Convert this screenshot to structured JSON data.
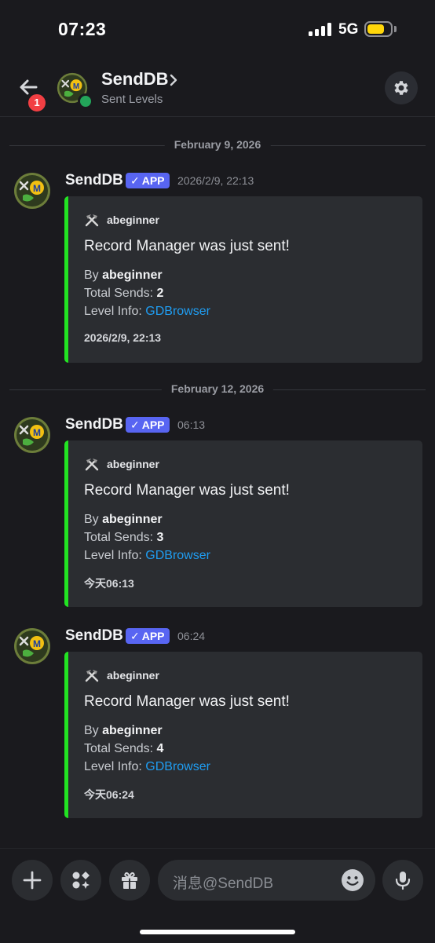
{
  "status_bar": {
    "time": "07:23",
    "network": "5G",
    "battery_level": 0.75
  },
  "header": {
    "badge_count": "1",
    "title": "SendDB",
    "subtitle": "Sent Levels"
  },
  "dates": [
    "February 9, 2026",
    "February 12, 2026"
  ],
  "messages": [
    {
      "author": "SendDB",
      "tag": "APP",
      "tag_check": "✓",
      "time": "2026/2/9, 22:13",
      "embed": {
        "author": "abeginner",
        "title": "Record Manager was just sent!",
        "by_label": "By",
        "by_value": "abeginner",
        "sends_label": "Total Sends:",
        "sends_value": "2",
        "level_label": "Level Info:",
        "level_link": "GDBrowser",
        "footer": "2026/2/9, 22:13"
      }
    },
    {
      "author": "SendDB",
      "tag": "APP",
      "tag_check": "✓",
      "time": "06:13",
      "embed": {
        "author": "abeginner",
        "title": "Record Manager was just sent!",
        "by_label": "By",
        "by_value": "abeginner",
        "sends_label": "Total Sends:",
        "sends_value": "3",
        "level_label": "Level Info:",
        "level_link": "GDBrowser",
        "footer": "今天06:13"
      }
    },
    {
      "author": "SendDB",
      "tag": "APP",
      "tag_check": "✓",
      "time": "06:24",
      "embed": {
        "author": "abeginner",
        "title": "Record Manager was just sent!",
        "by_label": "By",
        "by_value": "abeginner",
        "sends_label": "Total Sends:",
        "sends_value": "4",
        "level_label": "Level Info:",
        "level_link": "GDBrowser",
        "footer": "今天06:24"
      }
    }
  ],
  "input": {
    "placeholder": "消息@SendDB"
  },
  "colors": {
    "embed_accent": "#22e322",
    "app_tag": "#5865f2",
    "link": "#1f9df2",
    "badge": "#f23f43",
    "online": "#23a55a"
  },
  "icons": {
    "back": "arrow-left-icon",
    "settings": "gear-icon",
    "add": "plus-icon",
    "apps": "apps-icon",
    "gift": "gift-icon",
    "emoji": "emoji-icon",
    "mic": "microphone-icon",
    "embed_author": "hammer-pick-icon"
  }
}
